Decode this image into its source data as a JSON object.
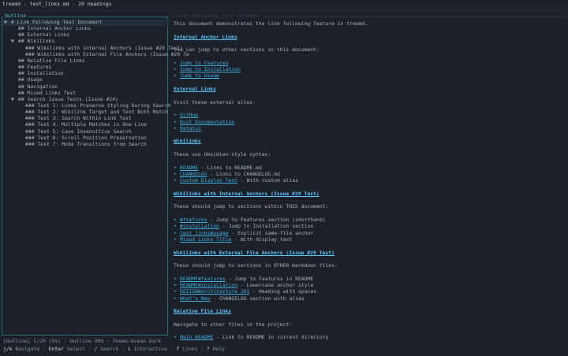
{
  "app": {
    "title": "treemd - test_links.md - 20 headings"
  },
  "outline": {
    "label": "Outline",
    "items": [
      {
        "marker": "▼",
        "text": "# Link Following Test Document",
        "indent": 0,
        "selected": true
      },
      {
        "marker": "",
        "text": "## Internal Anchor Links",
        "indent": 1
      },
      {
        "marker": "",
        "text": "## External Links",
        "indent": 1
      },
      {
        "marker": "▼",
        "text": "## Wikilinks",
        "indent": 1
      },
      {
        "marker": "",
        "text": "### Wikilinks with Internal Anchors (Issue #29 Test)",
        "indent": 2
      },
      {
        "marker": "",
        "text": "### Wikilinks with External File Anchors (Issue #29 Te",
        "indent": 2
      },
      {
        "marker": "",
        "text": "## Relative File Links",
        "indent": 1
      },
      {
        "marker": "",
        "text": "## Features",
        "indent": 1
      },
      {
        "marker": "",
        "text": "## Installation",
        "indent": 1
      },
      {
        "marker": "",
        "text": "## Usage",
        "indent": 1
      },
      {
        "marker": "",
        "text": "## Navigation",
        "indent": 1
      },
      {
        "marker": "",
        "text": "## Mixed Links Test",
        "indent": 1
      },
      {
        "marker": "▼",
        "text": "## Search Issue Tests (Issue #34)",
        "indent": 1
      },
      {
        "marker": "",
        "text": "### Test 1: Links Preserve Styling During Search",
        "indent": 2
      },
      {
        "marker": "",
        "text": "### Test 2: Wikilink Target and Text Both Match",
        "indent": 2
      },
      {
        "marker": "",
        "text": "### Test 3: Search Within Link Text",
        "indent": 2
      },
      {
        "marker": "",
        "text": "### Test 4: Multiple Matches in One Line",
        "indent": 2
      },
      {
        "marker": "",
        "text": "### Test 5: Case Insensitive Search",
        "indent": 2
      },
      {
        "marker": "",
        "text": "### Test 6: Scroll Position Preservation",
        "indent": 2
      },
      {
        "marker": "",
        "text": "### Test 7: Mode Transitions from Search",
        "indent": 2
      }
    ]
  },
  "content": {
    "title": "Link Following Test Document",
    "intro": "This document demonstrates the link following feature in treemd.",
    "sections": [
      {
        "heading": "Internal Anchor Links",
        "desc": "You can jump to other sections in this document:",
        "links": [
          [
            "Jump to Features",
            ""
          ],
          [
            "Jump to Installation",
            ""
          ],
          [
            "Jump to Usage",
            ""
          ]
        ]
      },
      {
        "heading": "External Links",
        "desc": "Visit these external sites:",
        "links": [
          [
            "GitHub",
            ""
          ],
          [
            "Rust Documentation",
            ""
          ],
          [
            "Ratatui",
            ""
          ]
        ]
      },
      {
        "heading": "Wikilinks",
        "desc": "These use Obsidian-style syntax:",
        "links": [
          [
            "README",
            " - Links to README.md"
          ],
          [
            "CHANGELOG",
            " - Links to CHANGELOG.md"
          ],
          [
            "Custom Display Text",
            " - With custom alias"
          ]
        ]
      },
      {
        "heading": "Wikilinks with Internal Anchors (Issue #29 Test)",
        "desc": "These should jump to sections within THIS document:",
        "links": [
          [
            "#features",
            " - Jump to Features section (shorthand)"
          ],
          [
            "#installation",
            " - Jump to Installation section"
          ],
          [
            "test_links#usage",
            " - Explicit same-file anchor"
          ],
          [
            "Mixed Links Title",
            " - With display text"
          ]
        ]
      },
      {
        "heading": "Wikilinks with External File Anchors (Issue #29 Test)",
        "desc": "These should jump to sections in OTHER markdown files:",
        "links": [
          [
            "README#features",
            " - Jump to Features in README"
          ],
          [
            "README#installation",
            " - Lowercase anchor style"
          ],
          [
            "DESIGN#architecture 101",
            " - Heading with spaces"
          ],
          [
            "What's New",
            " - CHANGELOG section with alias"
          ]
        ]
      },
      {
        "heading": "Relative File Links",
        "desc": "Navigate to other files in the project:",
        "links": [
          [
            "Main README",
            " - Link to README in current directory"
          ]
        ]
      }
    ]
  },
  "status_bar": {
    "mode": "[Outline]",
    "position": "1/20 (5%)",
    "outline_width": "Outline 30%",
    "theme": "Theme:Ocean Dark"
  },
  "help_bar": [
    {
      "key": "j/k",
      "label": "Navigate"
    },
    {
      "key": "Enter",
      "label": "Select"
    },
    {
      "key": "/",
      "label": "Search"
    },
    {
      "key": "i",
      "label": "Interactive"
    },
    {
      "key": "f",
      "label": "Links"
    },
    {
      "key": "?",
      "label": "Help"
    }
  ],
  "colors": {
    "background": "#1c2129",
    "border_active": "#2a6f78",
    "heading": "#60c7ff",
    "link": "#3fb0e0"
  }
}
